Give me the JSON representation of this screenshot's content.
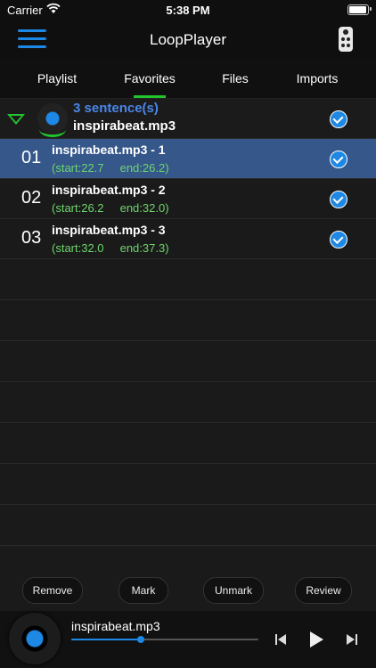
{
  "status_bar": {
    "carrier": "Carrier",
    "time": "5:38 PM"
  },
  "nav": {
    "title": "LoopPlayer"
  },
  "tabs": [
    {
      "label": "Playlist"
    },
    {
      "label": "Favorites"
    },
    {
      "label": "Files"
    },
    {
      "label": "Imports"
    }
  ],
  "active_tab": "Favorites",
  "group": {
    "count": "3 sentence(s)",
    "file": "inspirabeat.mp3"
  },
  "rows": [
    {
      "num": "01",
      "name": "inspirabeat.mp3 - 1",
      "time": "(start:22.7     end:26.2)"
    },
    {
      "num": "02",
      "name": "inspirabeat.mp3 - 2",
      "time": "(start:26.2     end:32.0)"
    },
    {
      "num": "03",
      "name": "inspirabeat.mp3 - 3",
      "time": "(start:32.0     end:37.3)"
    }
  ],
  "actions": {
    "remove": "Remove",
    "mark": "Mark",
    "unmark": "Unmark",
    "review": "Review"
  },
  "player": {
    "title": "inspirabeat.mp3",
    "progress": 0.37
  },
  "colors": {
    "accent_blue": "#1e88e5",
    "accent_green": "#22c32e",
    "selected_row": "#35578a",
    "time_text": "#6cd66c"
  }
}
